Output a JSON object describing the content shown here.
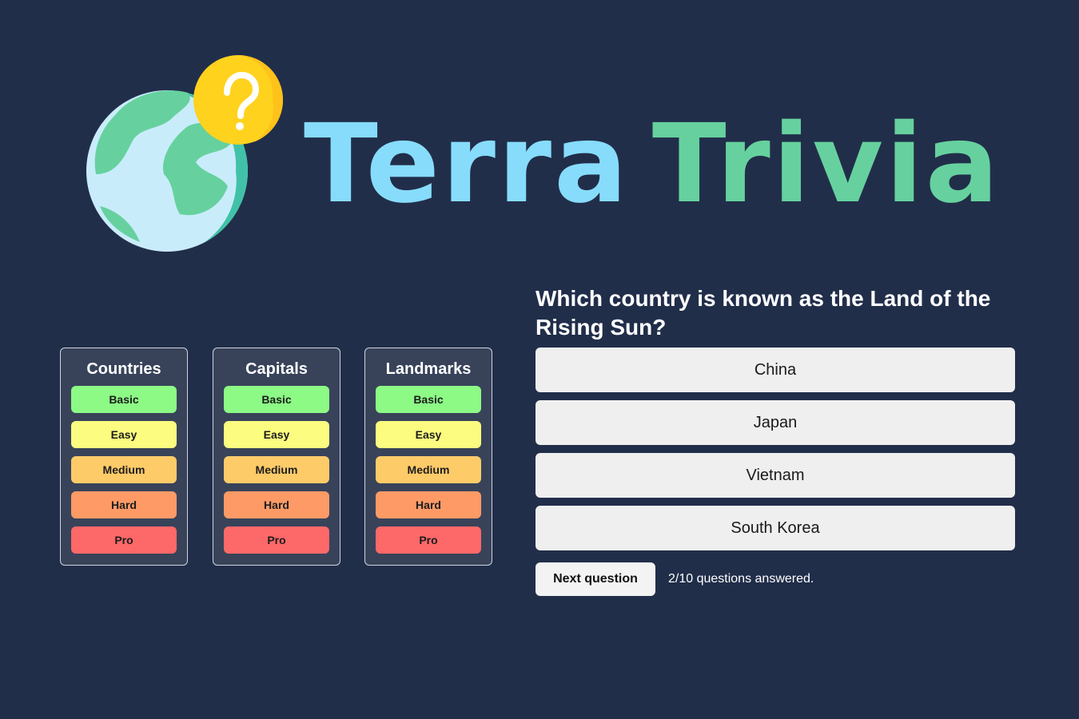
{
  "brand": {
    "word1": "Terra",
    "word2": "Trivia",
    "colors": {
      "word1": "#87dcfb",
      "word2": "#66d19e",
      "background": "#212e4a"
    },
    "logo_icon": "globe-question-icon"
  },
  "categories": [
    {
      "title": "Countries",
      "levels": [
        "Basic",
        "Easy",
        "Medium",
        "Hard",
        "Pro"
      ]
    },
    {
      "title": "Capitals",
      "levels": [
        "Basic",
        "Easy",
        "Medium",
        "Hard",
        "Pro"
      ]
    },
    {
      "title": "Landmarks",
      "levels": [
        "Basic",
        "Easy",
        "Medium",
        "Hard",
        "Pro"
      ]
    }
  ],
  "level_colors": {
    "Basic": "#8cfa85",
    "Easy": "#fbfc80",
    "Medium": "#fecb69",
    "Hard": "#fd9a66",
    "Pro": "#fd6868"
  },
  "quiz": {
    "question": "Which country is known as the Land of the Rising Sun?",
    "answers": [
      "China",
      "Japan",
      "Vietnam",
      "South Korea"
    ],
    "next_label": "Next question",
    "progress_text": "2/10 questions answered."
  }
}
